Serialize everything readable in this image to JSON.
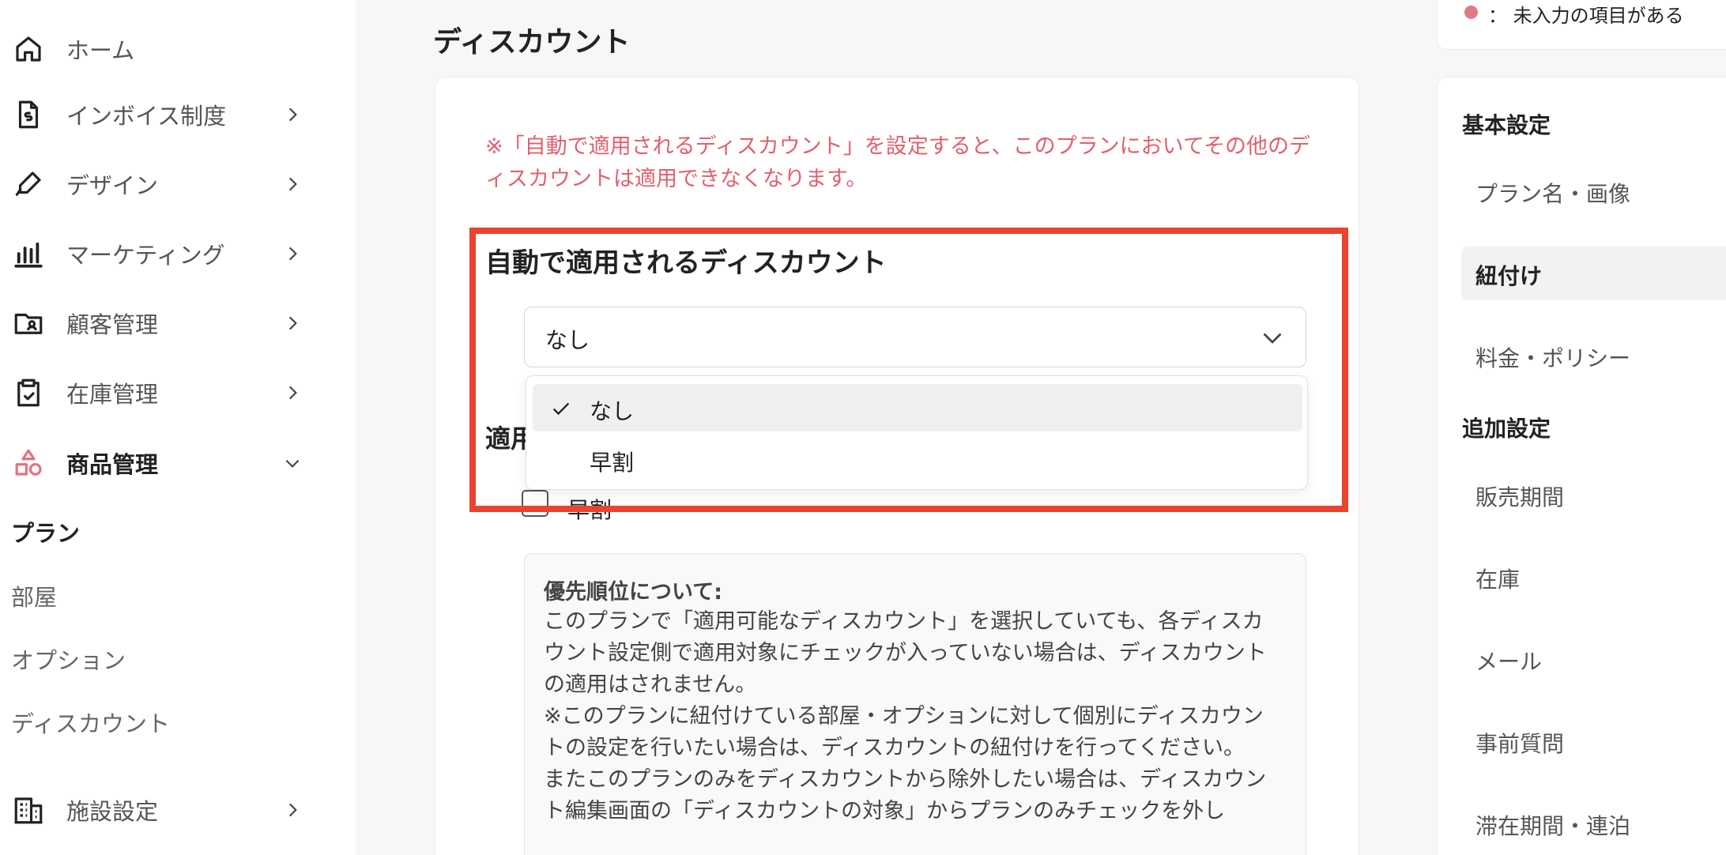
{
  "sidebar": {
    "nav": [
      {
        "label": "ホーム",
        "icon": "home-icon",
        "has_chevron": false
      },
      {
        "label": "インボイス制度",
        "icon": "invoice-icon",
        "has_chevron": true
      },
      {
        "label": "デザイン",
        "icon": "pen-icon",
        "has_chevron": true
      },
      {
        "label": "マーケティング",
        "icon": "bar-chart-icon",
        "has_chevron": true
      },
      {
        "label": "顧客管理",
        "icon": "customer-card-icon",
        "has_chevron": true
      },
      {
        "label": "在庫管理",
        "icon": "clipboard-check-icon",
        "has_chevron": true
      },
      {
        "label": "商品管理",
        "icon": "shapes-icon",
        "has_chevron": true,
        "expanded": true
      },
      {
        "label": "施設設定",
        "icon": "building-icon",
        "has_chevron": true
      }
    ],
    "sub_items": [
      {
        "label": "プラン",
        "active": true
      },
      {
        "label": "部屋"
      },
      {
        "label": "オプション"
      },
      {
        "label": "ディスカウント"
      }
    ]
  },
  "main": {
    "page_title": "ディスカウント",
    "warning": "※「自動で適用されるディスカウント」を設定すると、このプランにおいてその他のディスカウントは適用できなくなります。",
    "auto_discount_heading": "自動で適用されるディスカウント",
    "select_value": "なし",
    "dropdown_options": [
      {
        "label": "なし",
        "selected": true
      },
      {
        "label": "早割",
        "selected": false
      }
    ],
    "applicable_heading_partial": "適用",
    "checkbox_label": "早割",
    "info": {
      "title": "優先順位について:",
      "paragraphs": [
        "このプランで「適用可能なディスカウント」を選択していても、各ディスカウント設定側で適用対象にチェックが入っていない場合は、ディスカウントの適用はされません。",
        "※このプランに紐付けている部屋・オプションに対して個別にディスカウントの設定を行いたい場合は、ディスカウントの紐付けを行ってください。",
        "またこのプランのみをディスカウントから除外したい場合は、ディスカウント編集画面の「ディスカウントの対象」からプランのみチェックを外し"
      ]
    }
  },
  "right_nav": {
    "legend": {
      "symbol": "：",
      "text": "未入力の項目がある",
      "dot_color": "#e27a86"
    },
    "groups": [
      {
        "title": "基本設定",
        "items": [
          {
            "label": "プラン名・画像"
          },
          {
            "label": "紐付け",
            "active": true
          },
          {
            "label": "料金・ポリシー"
          }
        ]
      },
      {
        "title": "追加設定",
        "items": [
          {
            "label": "販売期間"
          },
          {
            "label": "在庫"
          },
          {
            "label": "メール"
          },
          {
            "label": "事前質問"
          },
          {
            "label": "滞在期間・連泊"
          }
        ]
      }
    ]
  },
  "colors": {
    "warning_text": "#e0606e",
    "highlight_border": "#e8442e",
    "accent_icon": "#e8707d"
  }
}
